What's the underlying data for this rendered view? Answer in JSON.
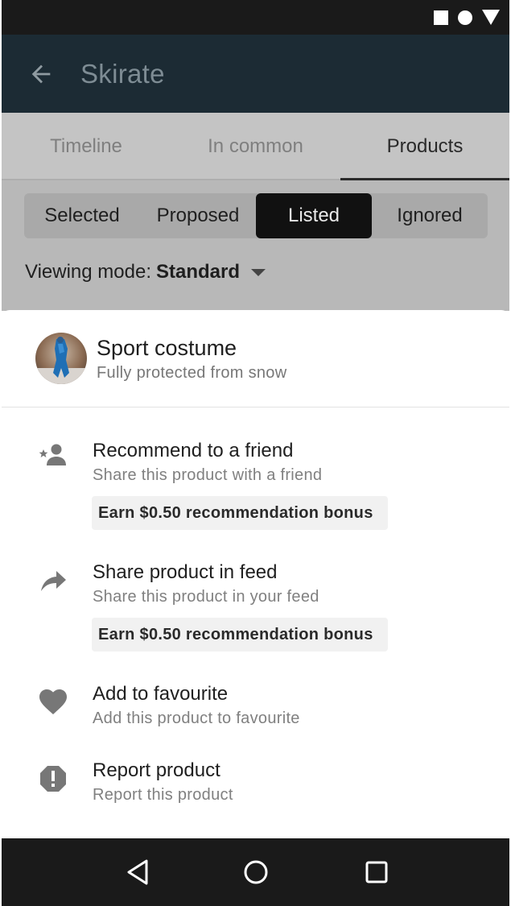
{
  "status_bar": {
    "icons": [
      "square-icon",
      "circle-icon",
      "triangle-icon"
    ]
  },
  "header": {
    "title": "Skirate",
    "back_icon": "arrow-left-icon"
  },
  "tabs": [
    {
      "label": "Timeline",
      "active": false
    },
    {
      "label": "In common",
      "active": false
    },
    {
      "label": "Products",
      "active": true
    }
  ],
  "segments": [
    {
      "label": "Selected",
      "active": false
    },
    {
      "label": "Proposed",
      "active": false
    },
    {
      "label": "Listed",
      "active": true
    },
    {
      "label": "Ignored",
      "active": false
    }
  ],
  "viewing_mode": {
    "label": "Viewing mode:",
    "value": "Standard"
  },
  "product": {
    "name": "Sport costume",
    "description": "Fully protected from snow"
  },
  "actions": [
    {
      "icon": "person-star-icon",
      "title": "Recommend to a friend",
      "subtitle": "Share this product with a friend",
      "bonus": "Earn $0.50 recommendation bonus"
    },
    {
      "icon": "share-arrow-icon",
      "title": "Share product in feed",
      "subtitle": "Share this product in your feed",
      "bonus": "Earn $0.50 recommendation bonus"
    },
    {
      "icon": "heart-icon",
      "title": "Add to favourite",
      "subtitle": "Add this product to favourite"
    },
    {
      "icon": "report-icon",
      "title": "Report product",
      "subtitle": "Report this product"
    }
  ],
  "nav_bar": {
    "icons": [
      "back-triangle-icon",
      "home-circle-icon",
      "recents-square-icon"
    ]
  },
  "colors": {
    "status_bar": "#1a1a1a",
    "app_bar_dimmed": "#1c2b34",
    "segment_active": "#111111",
    "icon_gray": "#777777"
  }
}
